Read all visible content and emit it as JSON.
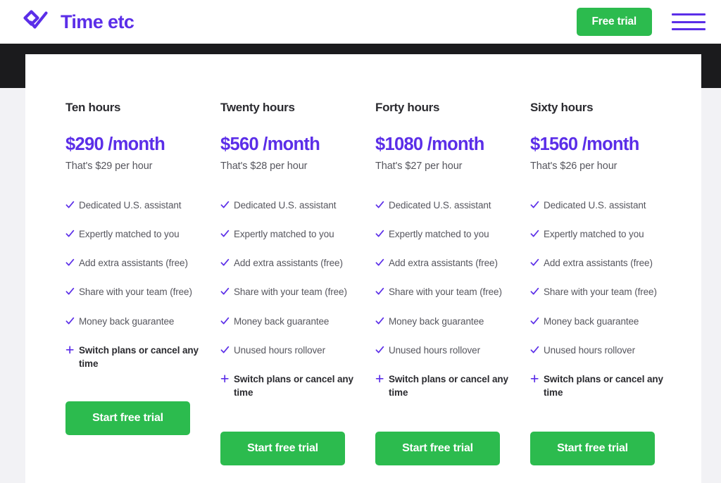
{
  "header": {
    "brand_name": "Time etc",
    "brand_mark": "check-diamond-logo",
    "free_trial_label": "Free trial",
    "menu_icon": "hamburger-menu-icon"
  },
  "colors": {
    "brand_purple": "#5B2EE8",
    "cta_green": "#2CBB4E",
    "dark_band": "#1B1B1D",
    "page_background": "#F2F2F5",
    "card_background": "#FFFFFF",
    "body_text": "#56565E",
    "heading_text": "#2B2B30"
  },
  "plans": [
    {
      "name": "Ten hours",
      "price": "$290 /month",
      "rate": "That's $29 per hour",
      "cta_label": "Start free trial",
      "features": [
        {
          "icon": "check-icon",
          "text": "Dedicated U.S. assistant",
          "emphasis": false
        },
        {
          "icon": "check-icon",
          "text": "Expertly matched to you",
          "emphasis": false
        },
        {
          "icon": "check-icon",
          "text": "Add extra assistants (free)",
          "emphasis": false
        },
        {
          "icon": "check-icon",
          "text": "Share with your team (free)",
          "emphasis": false
        },
        {
          "icon": "check-icon",
          "text": "Money back guarantee",
          "emphasis": false
        },
        {
          "icon": "plus-icon",
          "text": "Switch plans or cancel any time",
          "emphasis": true
        }
      ]
    },
    {
      "name": "Twenty hours",
      "price": "$560 /month",
      "rate": "That's $28 per hour",
      "cta_label": "Start free trial",
      "features": [
        {
          "icon": "check-icon",
          "text": "Dedicated U.S. assistant",
          "emphasis": false
        },
        {
          "icon": "check-icon",
          "text": "Expertly matched to you",
          "emphasis": false
        },
        {
          "icon": "check-icon",
          "text": "Add extra assistants (free)",
          "emphasis": false
        },
        {
          "icon": "check-icon",
          "text": "Share with your team (free)",
          "emphasis": false
        },
        {
          "icon": "check-icon",
          "text": "Money back guarantee",
          "emphasis": false
        },
        {
          "icon": "check-icon",
          "text": "Unused hours rollover",
          "emphasis": false
        },
        {
          "icon": "plus-icon",
          "text": "Switch plans or cancel any time",
          "emphasis": true
        }
      ]
    },
    {
      "name": "Forty hours",
      "price": "$1080 /month",
      "rate": "That's $27 per hour",
      "cta_label": "Start free trial",
      "features": [
        {
          "icon": "check-icon",
          "text": "Dedicated U.S. assistant",
          "emphasis": false
        },
        {
          "icon": "check-icon",
          "text": "Expertly matched to you",
          "emphasis": false
        },
        {
          "icon": "check-icon",
          "text": "Add extra assistants (free)",
          "emphasis": false
        },
        {
          "icon": "check-icon",
          "text": "Share with your team (free)",
          "emphasis": false
        },
        {
          "icon": "check-icon",
          "text": "Money back guarantee",
          "emphasis": false
        },
        {
          "icon": "check-icon",
          "text": "Unused hours rollover",
          "emphasis": false
        },
        {
          "icon": "plus-icon",
          "text": "Switch plans or cancel any time",
          "emphasis": true
        }
      ]
    },
    {
      "name": "Sixty hours",
      "price": "$1560 /month",
      "rate": "That's $26 per hour",
      "cta_label": "Start free trial",
      "features": [
        {
          "icon": "check-icon",
          "text": "Dedicated U.S. assistant",
          "emphasis": false
        },
        {
          "icon": "check-icon",
          "text": "Expertly matched to you",
          "emphasis": false
        },
        {
          "icon": "check-icon",
          "text": "Add extra assistants (free)",
          "emphasis": false
        },
        {
          "icon": "check-icon",
          "text": "Share with your team (free)",
          "emphasis": false
        },
        {
          "icon": "check-icon",
          "text": "Money back guarantee",
          "emphasis": false
        },
        {
          "icon": "check-icon",
          "text": "Unused hours rollover",
          "emphasis": false
        },
        {
          "icon": "plus-icon",
          "text": "Switch plans or cancel any time",
          "emphasis": true
        }
      ]
    }
  ]
}
